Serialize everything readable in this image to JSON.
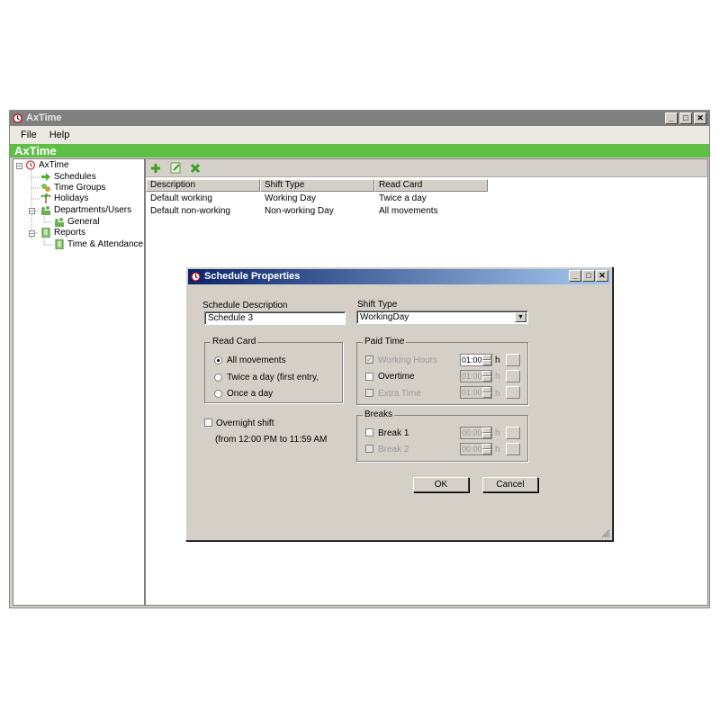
{
  "window": {
    "title": "AxTime",
    "controls": {
      "minimize": "_",
      "maximize": "□",
      "close": "✕"
    }
  },
  "menu": [
    "File",
    "Help"
  ],
  "banner": "AxTime",
  "tree": {
    "root": "AxTime",
    "schedules": "Schedules",
    "time_groups": "Time Groups",
    "holidays": "Holidays",
    "departments": "Departments/Users",
    "general": "General",
    "reports": "Reports",
    "time_attendance": "Time & Attendance"
  },
  "toolbar": {
    "add_icon": "plus-icon",
    "edit_icon": "edit-icon",
    "delete_icon": "delete-icon"
  },
  "grid": {
    "columns": [
      "Description",
      "Shift Type",
      "Read Card"
    ],
    "rows": [
      [
        "Default working",
        "Working Day",
        "Twice a day"
      ],
      [
        "Default non-working",
        "Non-working Day",
        "All movements"
      ]
    ]
  },
  "dialog": {
    "title": "Schedule Properties",
    "schedule_description_label": "Schedule Description",
    "schedule_description_value": "Schedule 3",
    "shift_type_label": "Shift Type",
    "shift_type_value": "WorkingDay",
    "read_card": {
      "title": "Read Card",
      "options": [
        "All movements",
        "Twice a day (first entry,",
        "Once a day"
      ],
      "selected": "All movements"
    },
    "overnight_label": "Overnight shift",
    "overnight_note": "(from 12:00 PM to 11:59 AM",
    "paid_time": {
      "title": "Paid Time",
      "working_hours_label": "Working Hours",
      "working_hours_value": "01:00",
      "overtime_label": "Overtime",
      "overtime_value": "01:00",
      "extra_time_label": "Extra Time",
      "extra_time_value": "01:00",
      "unit": "h"
    },
    "breaks": {
      "title": "Breaks",
      "break1_label": "Break 1",
      "break1_value": "00:00",
      "break2_label": "Break 2",
      "break2_value": "00:00",
      "unit": "h"
    },
    "ok_label": "OK",
    "cancel_label": "Cancel"
  }
}
